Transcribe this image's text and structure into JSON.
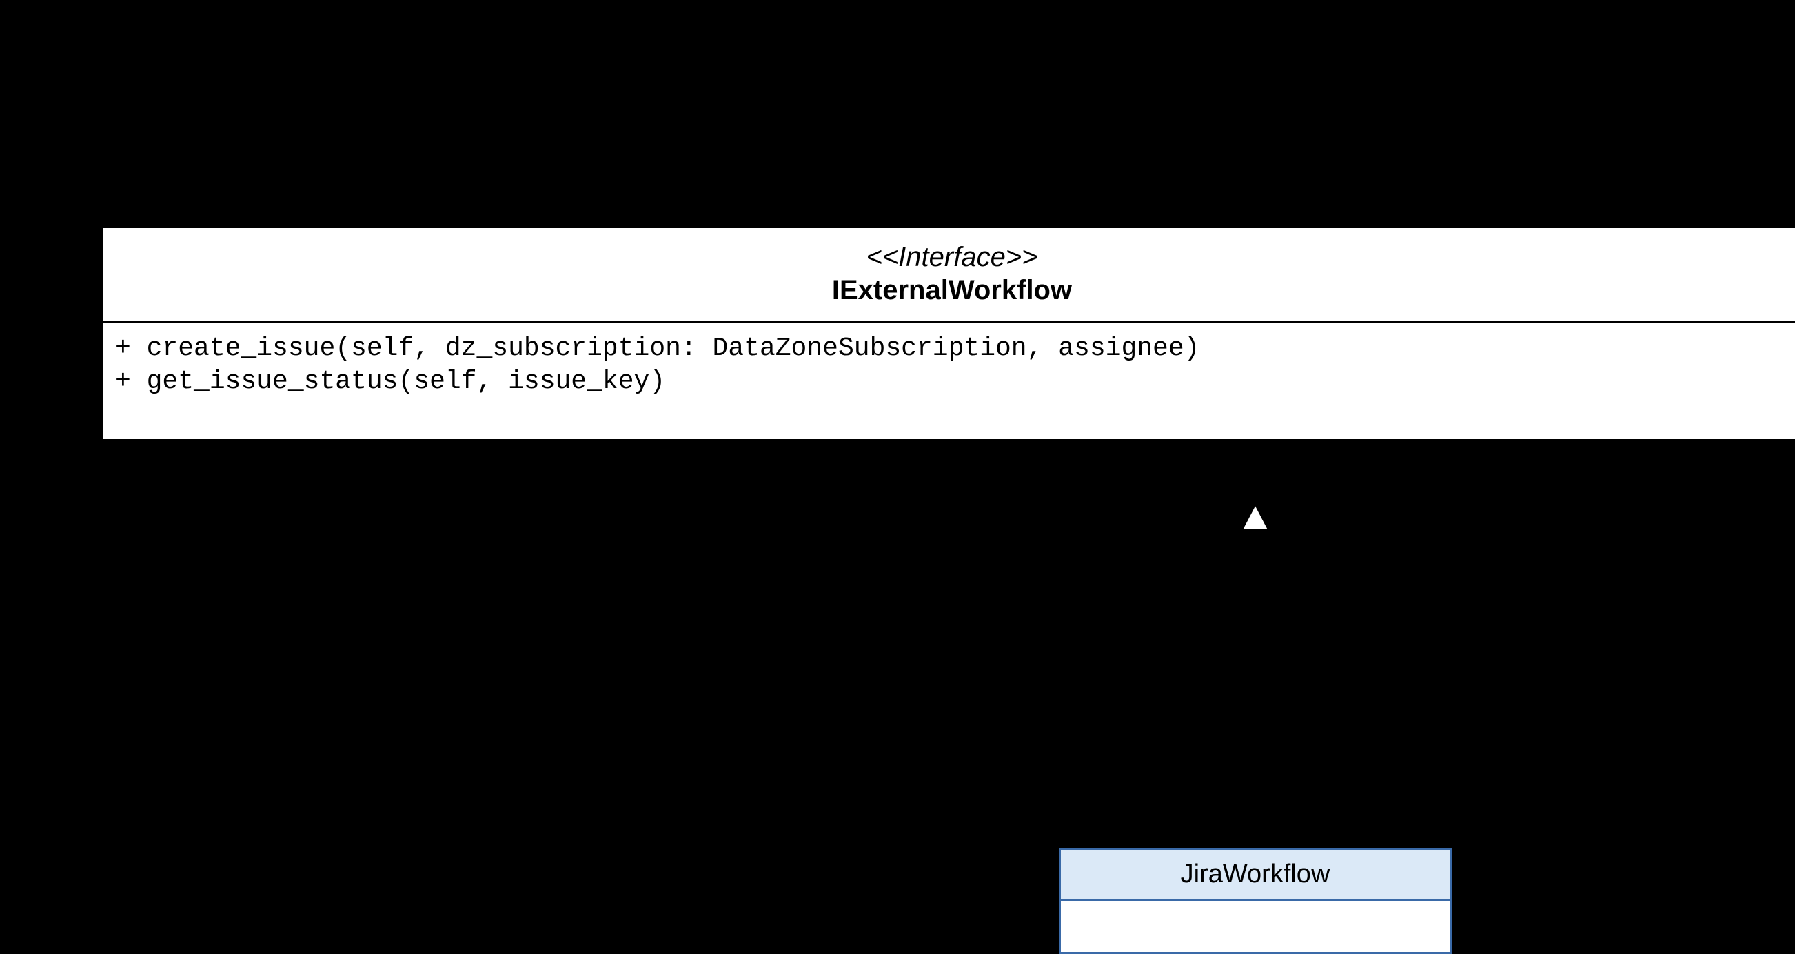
{
  "interface": {
    "stereotype": "<<Interface>>",
    "name": "IExternalWorkflow",
    "methods": [
      "+ create_issue(self, dz_subscription: DataZoneSubscription, assignee)",
      "+ get_issue_status(self, issue_key)"
    ]
  },
  "class": {
    "name": "JiraWorkflow"
  }
}
